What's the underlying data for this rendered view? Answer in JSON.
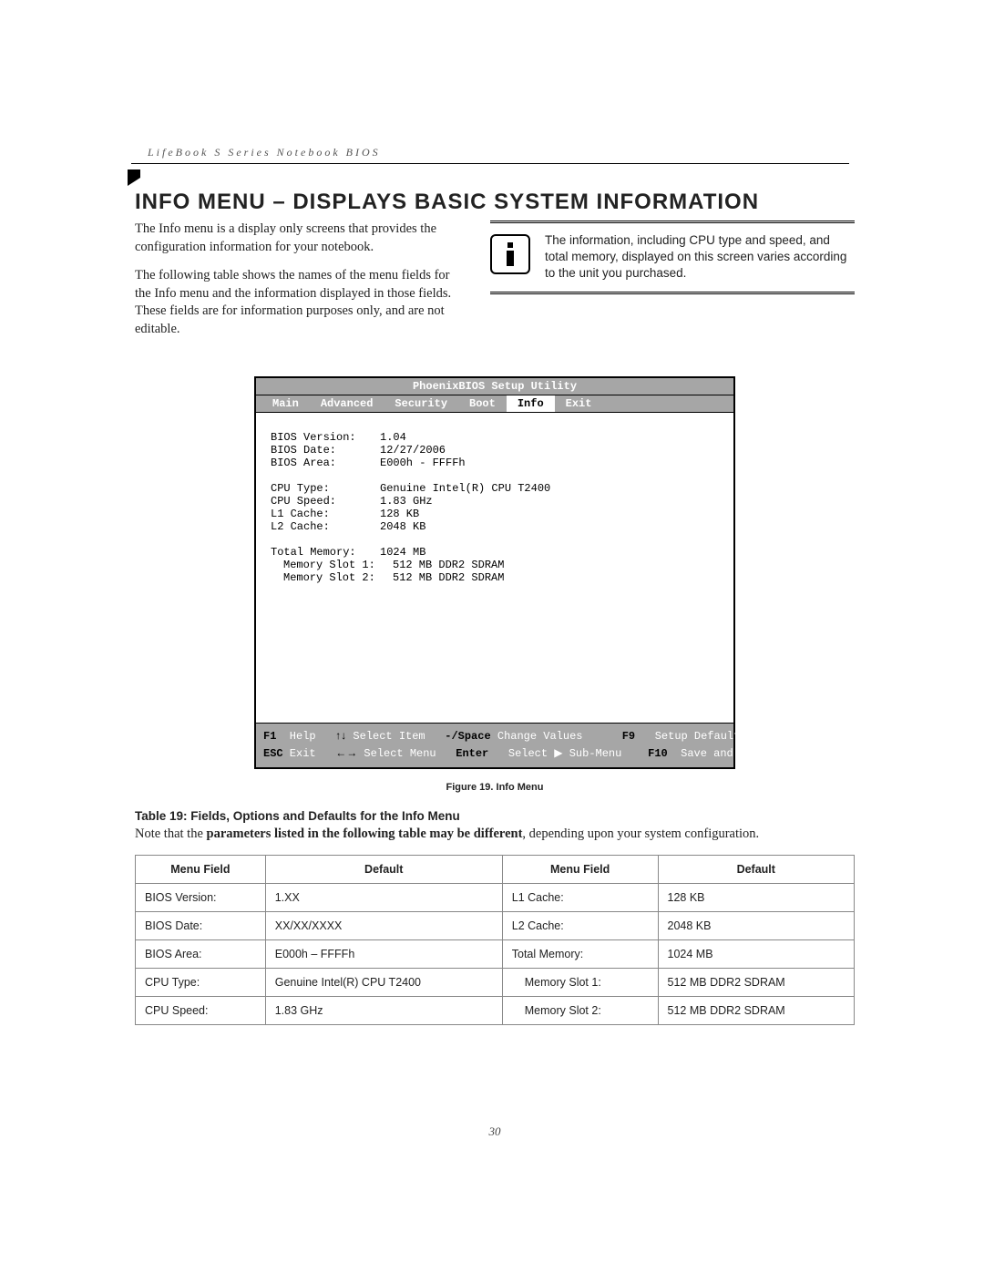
{
  "running_head": "LifeBook S Series Notebook BIOS",
  "title": "INFO MENU – DISPLAYS BASIC SYSTEM INFORMATION",
  "para1": "The Info menu is a display only screens that provides the configuration information for your notebook.",
  "para2": "The following table shows the names of the menu fields for the Info menu and the information displayed in those fields. These fields are for information purposes only, and are not editable.",
  "note_text": "The information, including CPU type and speed, and total memory, displayed on this screen varies according to the unit you purchased.",
  "bios": {
    "header": "PhoenixBIOS Setup Utility",
    "tabs": [
      "Main",
      "Advanced",
      "Security",
      "Boot",
      "Info",
      "Exit"
    ],
    "active_tab": "Info",
    "fields": [
      {
        "label": "BIOS Version:",
        "value": "1.04"
      },
      {
        "label": "BIOS Date:",
        "value": "12/27/2006"
      },
      {
        "label": "BIOS Area:",
        "value": "E000h - FFFFh"
      }
    ],
    "cpu_fields": [
      {
        "label": "CPU Type:",
        "value": "Genuine Intel(R) CPU T2400"
      },
      {
        "label": "CPU Speed:",
        "value": "1.83 GHz"
      },
      {
        "label": "L1 Cache:",
        "value": "128 KB"
      },
      {
        "label": "L2 Cache:",
        "value": "2048 KB"
      }
    ],
    "mem_fields": [
      {
        "label": "Total Memory:",
        "value": "1024 MB"
      },
      {
        "label": "Memory Slot 1:",
        "value": "512 MB DDR2 SDRAM",
        "indent": true
      },
      {
        "label": "Memory Slot 2:",
        "value": "512 MB DDR2 SDRAM",
        "indent": true
      }
    ],
    "footer": {
      "f1": "F1",
      "help": "Help",
      "sel_item": "Select Item",
      "change_vals_key": "-/Space",
      "change_vals": "Change Values",
      "f9": "F9",
      "setup_def": "Setup Defaults",
      "esc": "ESC",
      "exit": "Exit",
      "sel_menu": "Select Menu",
      "enter": "Enter",
      "sub_menu": "Select   Sub-Menu",
      "f10": "F10",
      "save_exit": "Save and Exit",
      "triangle": "▶",
      "updown": "↑↓",
      "leftright": "←→"
    }
  },
  "figure_caption": "Figure 19.   Info Menu",
  "table_title": "Table 19: Fields, Options and Defaults for the Info Menu",
  "table_note_prefix": "Note that the ",
  "table_note_bold": "parameters listed in the following table may be different",
  "table_note_suffix": ", depending upon your system configuration.",
  "table": {
    "headers": [
      "Menu Field",
      "Default",
      "Menu Field",
      "Default"
    ],
    "rows": [
      [
        "BIOS Version:",
        "1.XX",
        "L1 Cache:",
        "128 KB"
      ],
      [
        "BIOS Date:",
        "XX/XX/XXXX",
        "L2 Cache:",
        "2048 KB"
      ],
      [
        "BIOS Area:",
        "E000h – FFFFh",
        "Total Memory:",
        "1024 MB"
      ],
      [
        "CPU Type:",
        "Genuine Intel(R) CPU T2400",
        "Memory Slot 1:",
        "512 MB DDR2 SDRAM"
      ],
      [
        "CPU Speed:",
        "1.83 GHz",
        "Memory Slot 2:",
        "512 MB DDR2 SDRAM"
      ]
    ],
    "indent_right_col_from_row": 3
  },
  "page_number": "30"
}
